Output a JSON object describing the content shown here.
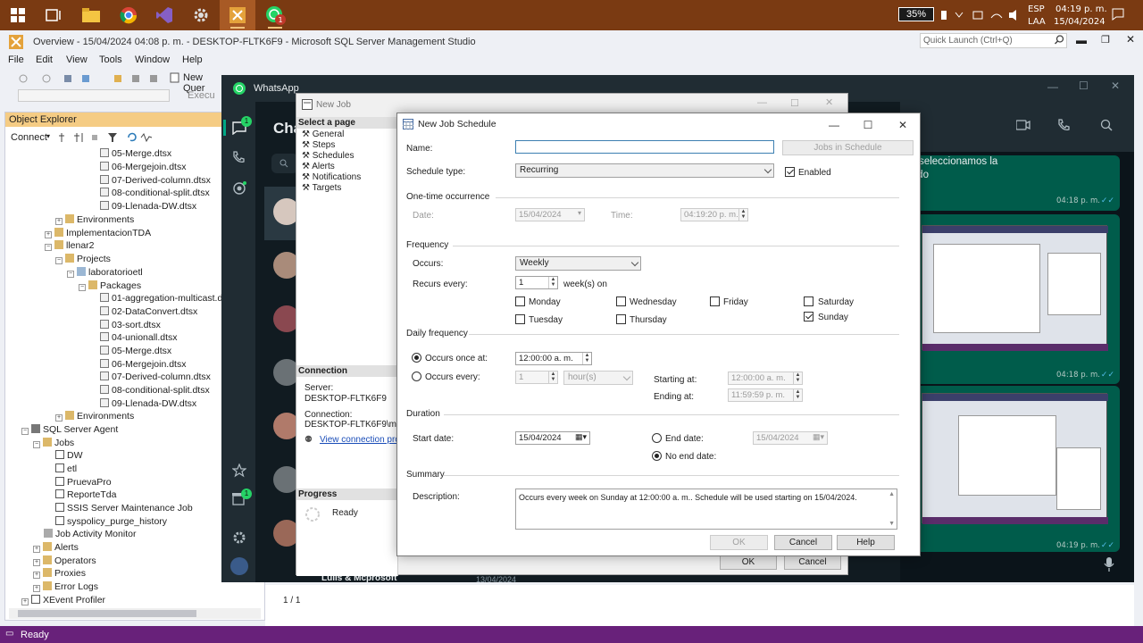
{
  "taskbar": {
    "battery": "35%",
    "lang1": "ESP",
    "lang2": "LAA",
    "time": "04:19 p. m.",
    "date": "15/04/2024"
  },
  "ssms": {
    "title": "Overview - 15/04/2024 04:08 p. m. - DESKTOP-FLTK6F9 - Microsoft SQL Server Management Studio",
    "quick_launch": "Quick Launch (Ctrl+Q)",
    "menu": [
      "File",
      "Edit",
      "View",
      "Tools",
      "Window",
      "Help"
    ],
    "toolbar_new_query": "New Quer",
    "toolbar_execute": "Execu",
    "status": "Ready"
  },
  "object_explorer": {
    "title": "Object Explorer",
    "connect": "Connect",
    "tree": [
      "05-Merge.dtsx",
      "06-Mergejoin.dtsx",
      "07-Derived-column.dtsx",
      "08-conditional-split.dtsx",
      "09-Llenada-DW.dtsx",
      "Environments",
      "ImplementacionTDA",
      "llenar2",
      "Projects",
      "laboratorioetl",
      "Packages",
      "01-aggregation-multicast.d",
      "02-DataConvert.dtsx",
      "03-sort.dtsx",
      "04-unionall.dtsx",
      "05-Merge.dtsx",
      "06-Mergejoin.dtsx",
      "07-Derived-column.dtsx",
      "08-conditional-split.dtsx",
      "09-Llenada-DW.dtsx",
      "Environments",
      "SQL Server Agent",
      "Jobs",
      "DW",
      "etl",
      "PruevaPro",
      "ReporteTda",
      "SSIS Server Maintenance Job",
      "syspolicy_purge_history",
      "Job Activity Monitor",
      "Alerts",
      "Operators",
      "Proxies",
      "Error Logs",
      "XEvent Profiler"
    ]
  },
  "whatsapp": {
    "title": "WhatsApp",
    "chats_label": "Cha",
    "rail_badge": "1",
    "rail_badge2": "1",
    "msg_text": "s, y seleccionamos la",
    "msg_text2": "enado",
    "ts1": "04:18 p. m.",
    "ts2": "04:18 p. m.",
    "ts3": "04:19 p. m.",
    "bottom_chat": "Lulis & Mcprosoft",
    "bottom_date": "13/04/2024",
    "page_count": "1 / 1"
  },
  "new_job": {
    "title": "New Job",
    "select_page": "Select a page",
    "pages": [
      "General",
      "Steps",
      "Schedules",
      "Alerts",
      "Notifications",
      "Targets"
    ],
    "connection_header": "Connection",
    "server_label": "Server:",
    "server_value": "DESKTOP-FLTK6F9",
    "connection_label": "Connection:",
    "connection_value": "DESKTOP-FLTK6F9\\mr(",
    "view_props": "View connection prop",
    "progress_header": "Progress",
    "progress_status": "Ready",
    "ok": "OK",
    "cancel": "Cancel"
  },
  "schedule": {
    "title": "New Job Schedule",
    "name_label": "Name:",
    "name_value": "",
    "jobs_in_schedule": "Jobs in Schedule",
    "schedule_type_label": "Schedule type:",
    "schedule_type": "Recurring",
    "enabled_label": "Enabled",
    "onetime_header": "One-time occurrence",
    "date_label": "Date:",
    "date_value": "15/04/2024",
    "time_label": "Time:",
    "time_value": "04:19:20 p. m.",
    "frequency_header": "Frequency",
    "occurs_label": "Occurs:",
    "occurs_value": "Weekly",
    "recurs_label": "Recurs every:",
    "recurs_value": "1",
    "recurs_unit": "week(s) on",
    "days": {
      "monday": "Monday",
      "tuesday": "Tuesday",
      "wednesday": "Wednesday",
      "thursday": "Thursday",
      "friday": "Friday",
      "saturday": "Saturday",
      "sunday": "Sunday"
    },
    "daily_header": "Daily frequency",
    "once_label": "Occurs once at:",
    "once_value": "12:00:00 a. m.",
    "every_label": "Occurs every:",
    "every_value": "1",
    "every_unit": "hour(s)",
    "starting_label": "Starting at:",
    "starting_value": "12:00:00 a. m.",
    "ending_label": "Ending at:",
    "ending_value": "11:59:59 p. m.",
    "duration_header": "Duration",
    "start_date_label": "Start date:",
    "start_date_value": "15/04/2024",
    "end_date_label": "End date:",
    "end_date_value": "15/04/2024",
    "no_end_label": "No end date:",
    "summary_header": "Summary",
    "description_label": "Description:",
    "description": "Occurs every week on Sunday at 12:00:00 a. m.. Schedule will be used starting on 15/04/2024.",
    "ok": "OK",
    "cancel": "Cancel",
    "help": "Help"
  }
}
